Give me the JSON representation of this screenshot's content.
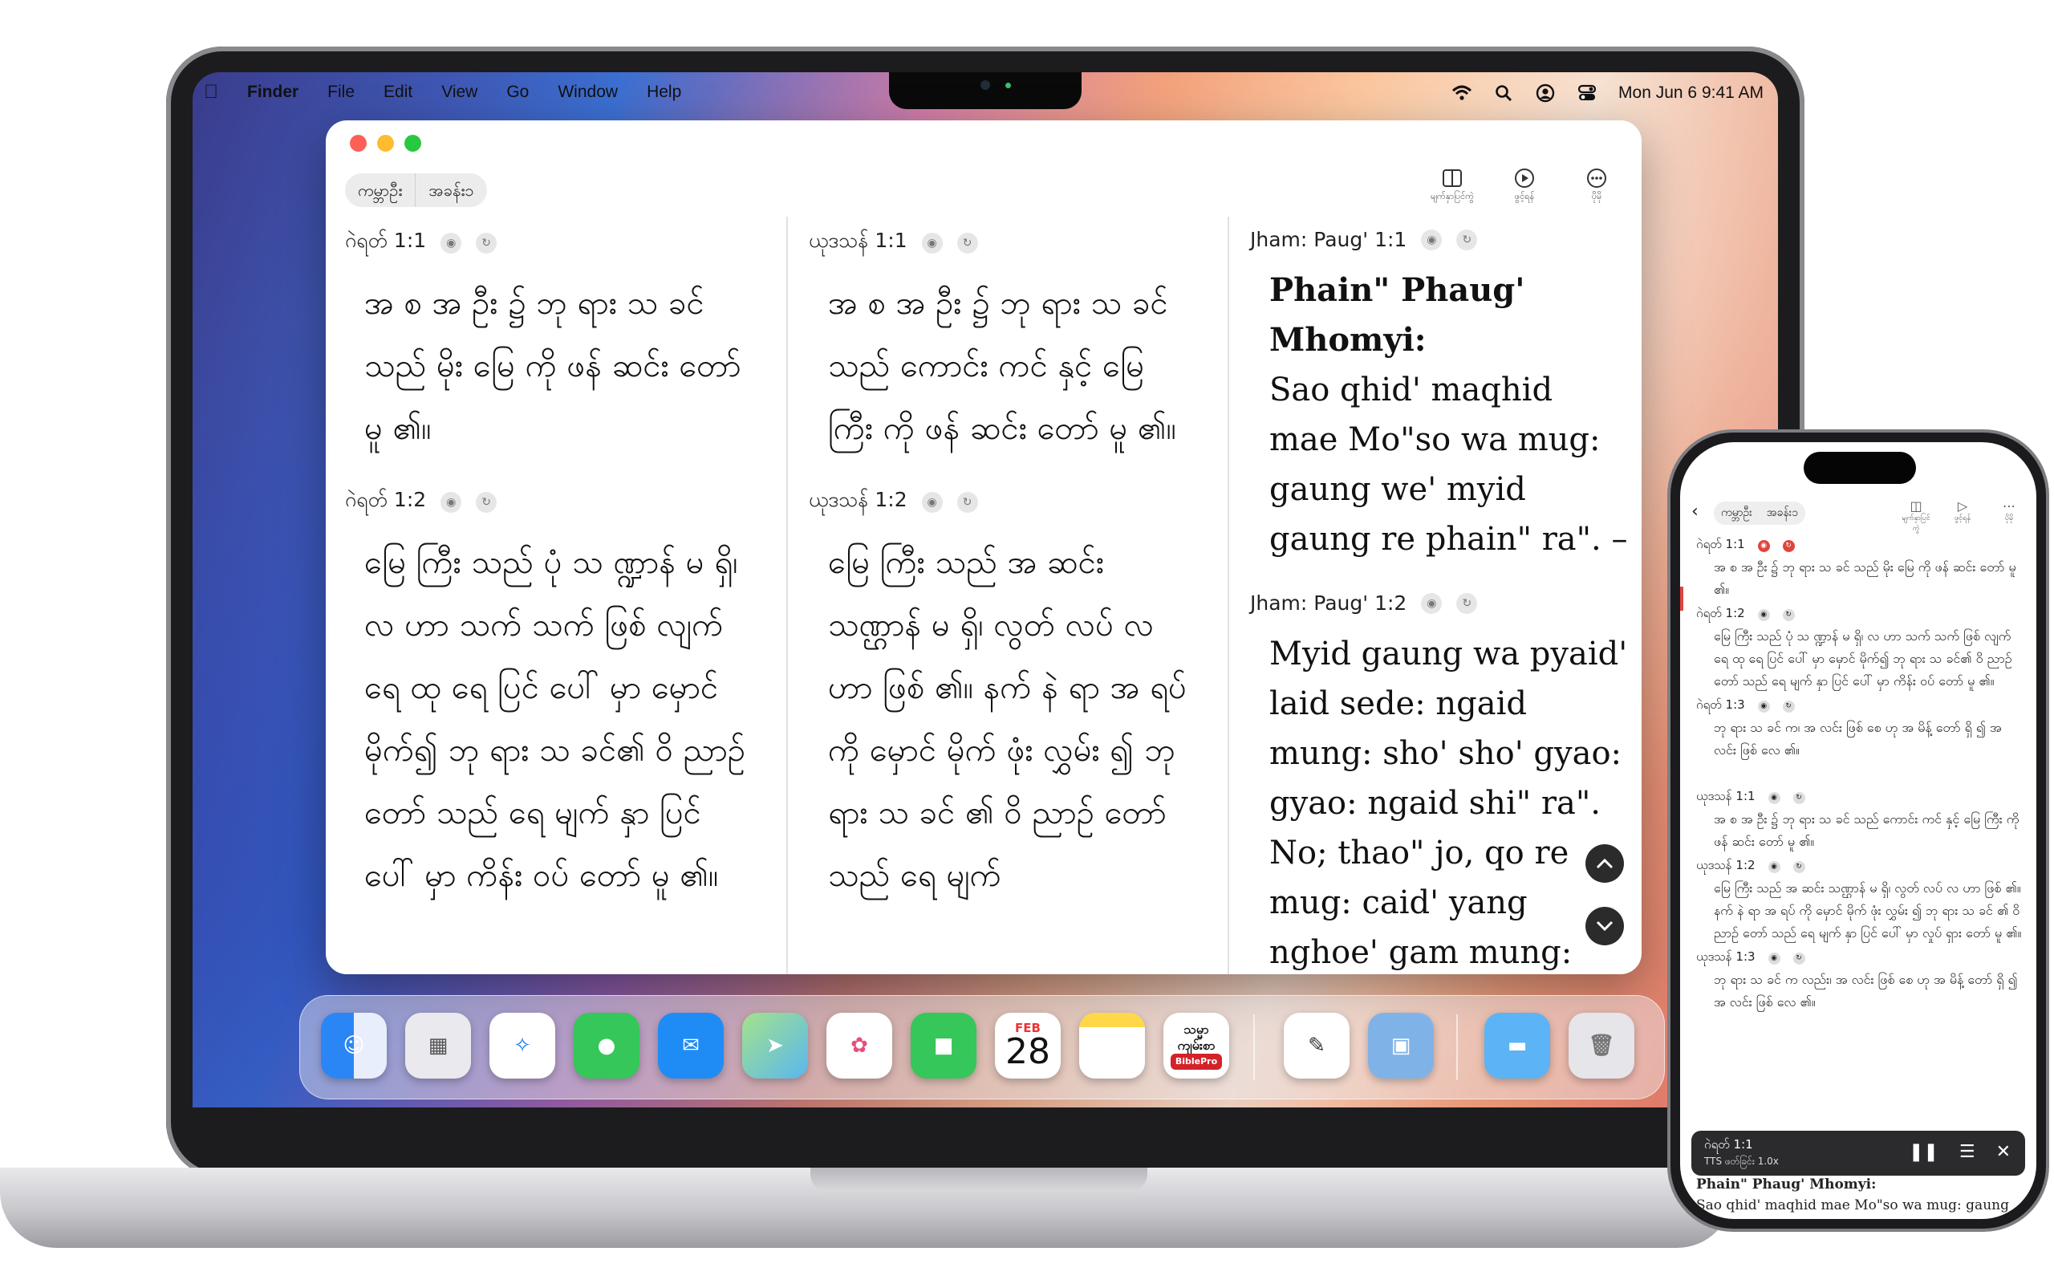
{
  "menubar": {
    "app": "Finder",
    "items": [
      "File",
      "Edit",
      "View",
      "Go",
      "Window",
      "Help"
    ],
    "clock": "Mon Jun 6  9:41 AM"
  },
  "window": {
    "segments": [
      "ကမ္ဘာဦး",
      "အခန်း၁"
    ],
    "tools": [
      "မျက်နှာပြင်ကွဲ",
      "ဖွင့်ရန်",
      "ပိုမို"
    ],
    "columns": [
      {
        "verses": [
          {
            "ref": "ဂဲရတ် 1:1",
            "text": "အ စ အ ဦး ၌ ဘု ရား သ ခင် သည် မိုး မြေ ကို ဖန် ဆင်း တော် မူ ၏။"
          },
          {
            "ref": "ဂဲရတ် 1:2",
            "text": "မြေ ကြီး သည် ပုံ သ ဏ္ဍာန် မ ရှိ၊ လ ဟာ သက် သက် ဖြစ် လျက် ရေ ထု ရေ ပြင် ပေါ် မှာ မှောင် မိုက်၍ ဘု ရား သ ခင်၏ ဝိ ညာဉ် တော် သည် ရေ မျက် နှာ ပြင် ပေါ် မှာ ကိန်း ဝပ် တော် မူ ၏။"
          }
        ]
      },
      {
        "verses": [
          {
            "ref": "ယုဒသန် 1:1",
            "text": "အ စ အ ဦး ၌ ဘု ရား သ ခင် သည် ကောင်း ကင် နှင့် မြေ ကြီး ကို ဖန် ဆင်း တော် မူ ၏။"
          },
          {
            "ref": "ယုဒသန် 1:2",
            "text": "မြေ ကြီး သည် အ ဆင်း သဏ္ဌာန် မ ရှိ၊ လွတ် လပ် လ ဟာ ဖြစ် ၏။ နက် နဲ ရာ အ ရပ် ကို မှောင် မိုက် ဖုံး လွှမ်း ၍ ဘု ရား သ ခင် ၏ ဝိ ညာဉ် တော် သည် ရေ မျက်"
          }
        ]
      },
      {
        "verses": [
          {
            "ref": "Jham: Paug' 1:1",
            "heading": "Phain\" Phaug' Mhomyi:",
            "text": "Sao qhid' maqhid mae Mo\"so wa mug: gaung we' myid gaung re phain\" ra\". –"
          },
          {
            "ref": "Jham: Paug' 1:2",
            "text": "Myid gaung wa pyaid' laid sede: ngaid mung: sho' sho' gyao: gyao: ngaid shi\" ra\". No; thao\" jo, qo re mug: caid' yang nghoe' gam mung: Mo\"so: Solo wa qid dae mae"
          }
        ]
      }
    ]
  },
  "dock": {
    "calendar_month": "FEB",
    "calendar_day": "28",
    "biblepro_line1": "သမ္မာ",
    "biblepro_line2": "ကျမ်းစာ",
    "biblepro_badge": "BiblePro"
  },
  "phone": {
    "segments": [
      "ကမ္ဘာဦး",
      "အခန်း၁"
    ],
    "tools": [
      "မျက်နှာပြင်ကွဲ",
      "ဖွင့်ရန်",
      "ပိုမို"
    ],
    "verses": [
      {
        "ref": "ဂဲရတ် 1:1",
        "text": "အ စ အ ဦး ၌ ဘု ရား သ ခင် သည် မိုး မြေ ကို ဖန် ဆင်း တော် မူ ၏။"
      },
      {
        "ref": "ဂဲရတ် 1:2",
        "text": "မြေ ကြီး သည် ပုံ သ ဏ္ဍာန် မ ရှိ၊ လ ဟာ သက် သက် ဖြစ် လျက် ရေ ထု ရေ ပြင် ပေါ် မှာ မှောင် မိုက်၍ ဘု ရား သ ခင်၏ ဝိ ညာဉ် တော် သည် ရေ မျက် နှာ ပြင် ပေါ် မှာ ကိန်း ဝပ် တော် မူ ၏။"
      },
      {
        "ref": "ဂဲရတ် 1:3",
        "text": "ဘု ရား သ ခင် က၊ အ လင်း ဖြစ် စေ ဟု အ မိန့် တော် ရှိ ၍ အ လင်း ဖြစ် လေ ၏။"
      },
      {
        "ref": "ယုဒသန် 1:1",
        "text": "အ စ အ ဦး ၌ ဘု ရား သ ခင် သည် ကောင်း ကင် နှင့် မြေ ကြီး ကို ဖန် ဆင်း တော် မူ ၏။"
      },
      {
        "ref": "ယုဒသန် 1:2",
        "text": "မြေ ကြီး သည် အ ဆင်း သဏ္ဌာန် မ ရှိ၊ လွတ် လပ် လ ဟာ ဖြစ် ၏။ နက် နဲ ရာ အ ရပ် ကို မှောင် မိုက် ဖုံး လွှမ်း ၍ ဘု ရား သ ခင် ၏ ဝိ ညာဉ် တော် သည် ရေ မျက် နှာ ပြင် ပေါ် မှာ လှုပ် ရှား တော် မူ ၏။"
      },
      {
        "ref": "ယုဒသန် 1:3",
        "text": "ဘု ရား သ ခင် က လည်း၊ အ လင်း ဖြစ် စေ ဟု အ မိန့် တော် ရှိ ၍ အ လင်း ဖြစ် လေ ၏။"
      }
    ],
    "player": {
      "ref": "ဂဲရတ် 1:1",
      "status": "TTS ဖတ်ခြင်း  1.0x"
    },
    "under_heading": "Phain\" Phaug' Mhomyi:",
    "under_text": "Sao qhid' maqhid mae Mo\"so wa mug: gaung we' myid gaung re phain\" ra\"."
  }
}
